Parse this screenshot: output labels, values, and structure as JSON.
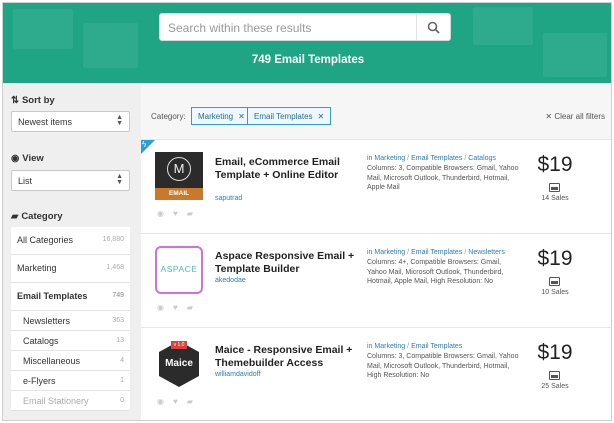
{
  "search": {
    "placeholder": "Search within these results"
  },
  "results_title": "749 Email Templates",
  "sidebar": {
    "sort_heading": "Sort by",
    "sort_value": "Newest items",
    "view_heading": "View",
    "view_value": "List",
    "category_heading": "Category",
    "categories": [
      {
        "label": "All Categories",
        "count": "16,880"
      },
      {
        "label": "Marketing",
        "count": "1,468"
      },
      {
        "label": "Email Templates",
        "count": "749"
      },
      {
        "label": "Newsletters",
        "count": "363"
      },
      {
        "label": "Catalogs",
        "count": "13"
      },
      {
        "label": "Miscellaneous",
        "count": "4"
      },
      {
        "label": "e-Flyers",
        "count": "1"
      },
      {
        "label": "Email Stationery",
        "count": "0"
      }
    ]
  },
  "filters": {
    "label": "Category:",
    "chips": [
      "Marketing",
      "Email Templates"
    ],
    "clear_all": "Clear all filters"
  },
  "items": [
    {
      "title": "Email, eCommerce Email Template + Online Editor",
      "author": "saputrad",
      "crumbs": [
        "Marketing",
        "Email Templates",
        "Catalogs"
      ],
      "description": "Columns: 3, Compatible Browsers: Gmail, Yahoo Mail, Microsoft Outlook, Thunderbird, Hotmail, Apple Mail",
      "price": "$19",
      "sales": "14 Sales",
      "thumb_text": "EMAIL",
      "thumb_letter": "M"
    },
    {
      "title": "Aspace Responsive Email + Template Builder",
      "author": "akedodae",
      "crumbs": [
        "Marketing",
        "Email Templates",
        "Newsletters"
      ],
      "description": "Columns: 4+, Compatible Browsers: Gmail, Yahoo Mail, Microsoft Outlook, Thunderbird, Hotmail, Apple Mail, High Resolution: No",
      "price": "$19",
      "sales": "10 Sales",
      "thumb_text": "ASPACE"
    },
    {
      "title": "Maice - Responsive Email + Themebuilder Access",
      "author": "williamdavidoff",
      "crumbs": [
        "Marketing",
        "Email Templates"
      ],
      "description": "Columns: 3, Compatible Browsers: Gmail, Yahoo Mail, Microsoft Outlook, Thunderbird, Hotmail, High Resolution: No",
      "price": "$19",
      "sales": "25 Sales",
      "thumb_text": "Maice",
      "thumb_badge": "v 1.0"
    }
  ],
  "colors": {
    "brand": "#1fa584",
    "link": "#2a7fb8",
    "chip_border": "#2a9fd6"
  }
}
